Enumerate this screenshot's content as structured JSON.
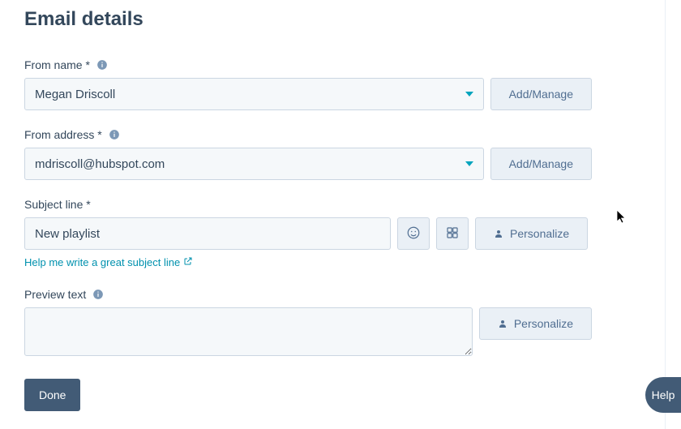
{
  "page": {
    "title": "Email details"
  },
  "from_name": {
    "label": "From name *",
    "value": "Megan Driscoll",
    "manage_label": "Add/Manage"
  },
  "from_address": {
    "label": "From address *",
    "value": "mdriscoll@hubspot.com",
    "manage_label": "Add/Manage"
  },
  "subject": {
    "label": "Subject line *",
    "value": "New playlist",
    "personalize_label": "Personalize",
    "help_link": "Help me write a great subject line"
  },
  "preview": {
    "label": "Preview text",
    "value": "",
    "personalize_label": "Personalize"
  },
  "actions": {
    "done": "Done"
  },
  "help": {
    "label": "Help"
  }
}
